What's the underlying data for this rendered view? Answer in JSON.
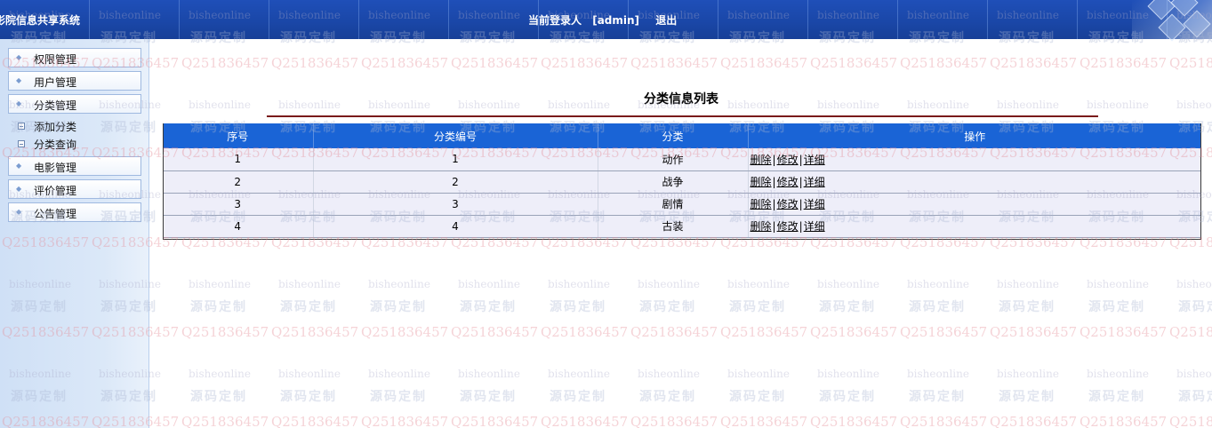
{
  "header": {
    "system_title": "影院信息共享系统",
    "login_label": "当前登录人",
    "user": "[admin]",
    "logout": "退出"
  },
  "sidebar": {
    "items": [
      {
        "label": "权限管理"
      },
      {
        "label": "用户管理"
      },
      {
        "label": "分类管理",
        "subitems": [
          {
            "label": "添加分类"
          },
          {
            "label": "分类查询"
          }
        ]
      },
      {
        "label": "电影管理"
      },
      {
        "label": "评价管理"
      },
      {
        "label": "公告管理"
      }
    ]
  },
  "main": {
    "title": "分类信息列表",
    "columns": [
      "序号",
      "分类编号",
      "分类",
      "操作"
    ],
    "rows": [
      {
        "index": "1",
        "code": "1",
        "category": "动作"
      },
      {
        "index": "2",
        "code": "2",
        "category": "战争"
      },
      {
        "index": "3",
        "code": "3",
        "category": "剧情"
      },
      {
        "index": "4",
        "code": "4",
        "category": "古装"
      }
    ],
    "actions": {
      "delete": "删除",
      "edit": "修改",
      "detail": "详细",
      "separator": "|"
    }
  },
  "watermark": {
    "line1": "bisheonline",
    "line2": "源码定制",
    "line3": "Q2518364​57"
  },
  "colors": {
    "header_blue": "#1f4fb8",
    "table_header": "#1a64d6",
    "row_bg": "#eeeef9",
    "title_line": "#7a1a1a"
  }
}
